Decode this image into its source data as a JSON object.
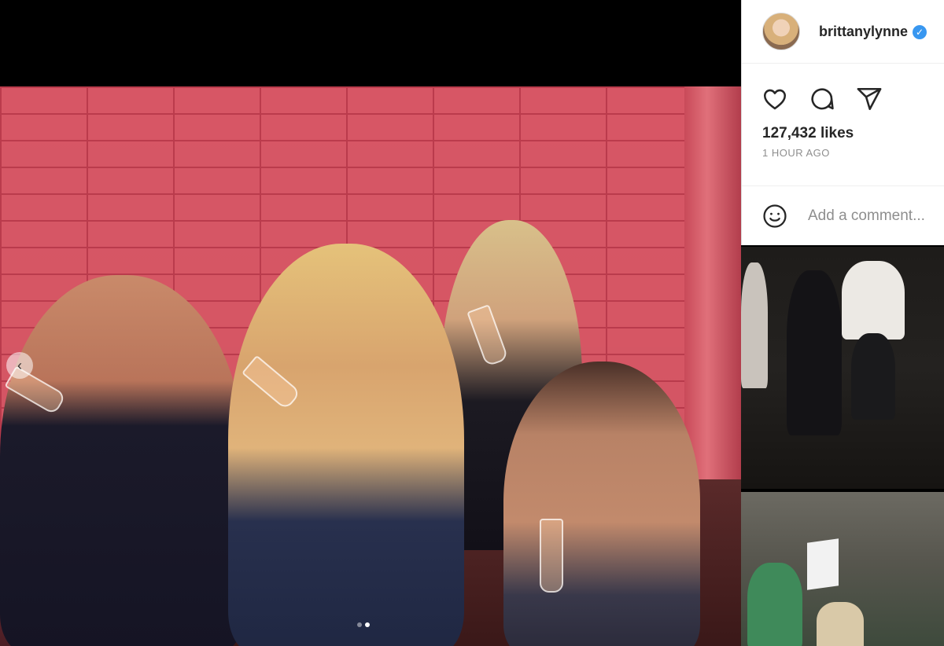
{
  "post": {
    "username": "brittanylynne",
    "verified_glyph": "✓",
    "likes": "127,432 likes",
    "timestamp": "1 HOUR AGO",
    "comment_placeholder": "Add a comment..."
  },
  "carousel": {
    "prev_glyph": "‹",
    "current_slide": 2,
    "total_slides": 2
  },
  "icons": {
    "like": "heart-icon",
    "comment": "comment-icon",
    "share": "share-icon",
    "emoji": "emoji-icon",
    "verified": "verified-badge-icon"
  },
  "colors": {
    "accent": "#3897f0",
    "text": "#262626",
    "muted": "#8e8e8e"
  }
}
